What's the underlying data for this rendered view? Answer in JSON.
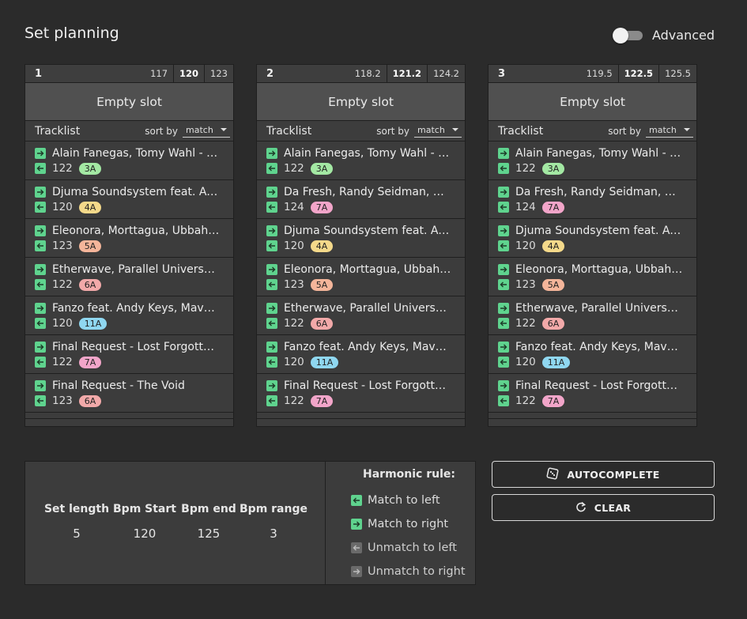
{
  "header": {
    "title": "Set planning",
    "advanced_label": "Advanced",
    "advanced_on": false
  },
  "slot_labels": {
    "empty": "Empty slot",
    "tracklist": "Tracklist",
    "sort_by": "sort by",
    "sort_value": "match"
  },
  "slots": [
    {
      "number": "1",
      "bpm_low": "117",
      "bpm_mid": "120",
      "bpm_high": "123",
      "tracks": [
        {
          "name": "Alain Fanegas, Tomy Wahl - Hidden",
          "bpm": "122",
          "key": "3A"
        },
        {
          "name": "Djuma Soundsystem feat. Aero Manyelo",
          "bpm": "120",
          "key": "4A"
        },
        {
          "name": "Eleonora, Morttagua, Ubbah, Stephan",
          "bpm": "123",
          "key": "5A"
        },
        {
          "name": "Etherwave, Parallel Universe - Green",
          "bpm": "122",
          "key": "6A"
        },
        {
          "name": "Fanzo feat. Andy Keys, Mavuthela",
          "bpm": "120",
          "key": "11A"
        },
        {
          "name": "Final Request - Lost Forgotten (Original Mix)",
          "bpm": "122",
          "key": "7A"
        },
        {
          "name": "Final Request - The Void",
          "bpm": "123",
          "key": "6A"
        }
      ]
    },
    {
      "number": "2",
      "bpm_low": "118.2",
      "bpm_mid": "121.2",
      "bpm_high": "124.2",
      "tracks": [
        {
          "name": "Alain Fanegas, Tomy Wahl - Hidden",
          "bpm": "122",
          "key": "3A"
        },
        {
          "name": "Da Fresh, Randy Seidman, Beckers",
          "bpm": "124",
          "key": "7A"
        },
        {
          "name": "Djuma Soundsystem feat. Aero Manyelo",
          "bpm": "120",
          "key": "4A"
        },
        {
          "name": "Eleonora, Morttagua, Ubbah, Stephan",
          "bpm": "123",
          "key": "5A"
        },
        {
          "name": "Etherwave, Parallel Universe - Green",
          "bpm": "122",
          "key": "6A"
        },
        {
          "name": "Fanzo feat. Andy Keys, Mavuthela",
          "bpm": "120",
          "key": "11A"
        },
        {
          "name": "Final Request - Lost Forgotten (Original Mix)",
          "bpm": "122",
          "key": "7A"
        }
      ]
    },
    {
      "number": "3",
      "bpm_low": "119.5",
      "bpm_mid": "122.5",
      "bpm_high": "125.5",
      "tracks": [
        {
          "name": "Alain Fanegas, Tomy Wahl - Hidden",
          "bpm": "122",
          "key": "3A"
        },
        {
          "name": "Da Fresh, Randy Seidman, Beckers",
          "bpm": "124",
          "key": "7A"
        },
        {
          "name": "Djuma Soundsystem feat. Aero Manyelo",
          "bpm": "120",
          "key": "4A"
        },
        {
          "name": "Eleonora, Morttagua, Ubbah, Stephan",
          "bpm": "123",
          "key": "5A"
        },
        {
          "name": "Etherwave, Parallel Universe - Green",
          "bpm": "122",
          "key": "6A"
        },
        {
          "name": "Fanzo feat. Andy Keys, Mavuthela",
          "bpm": "120",
          "key": "11A"
        },
        {
          "name": "Final Request - Lost Forgotten (Original Mix)",
          "bpm": "122",
          "key": "7A"
        }
      ]
    }
  ],
  "stats": {
    "set_length_label": "Set length",
    "set_length": "5",
    "bpm_start_label": "Bpm Start",
    "bpm_start": "120",
    "bpm_end_label": "Bpm end",
    "bpm_end": "125",
    "bpm_range_label": "Bpm range",
    "bpm_range": "3"
  },
  "harmonic": {
    "title": "Harmonic rule:",
    "match_left": "Match to left",
    "match_right": "Match to right",
    "unmatch_left": "Unmatch to left",
    "unmatch_right": "Unmatch to right"
  },
  "actions": {
    "autocomplete": "AUTOCOMPLETE",
    "clear": "CLEAR"
  },
  "colors": {
    "match": "#5fd38e",
    "unmatch": "#6a6a6a",
    "background": "#2b2b2b",
    "panel": "#3c3c3c"
  }
}
